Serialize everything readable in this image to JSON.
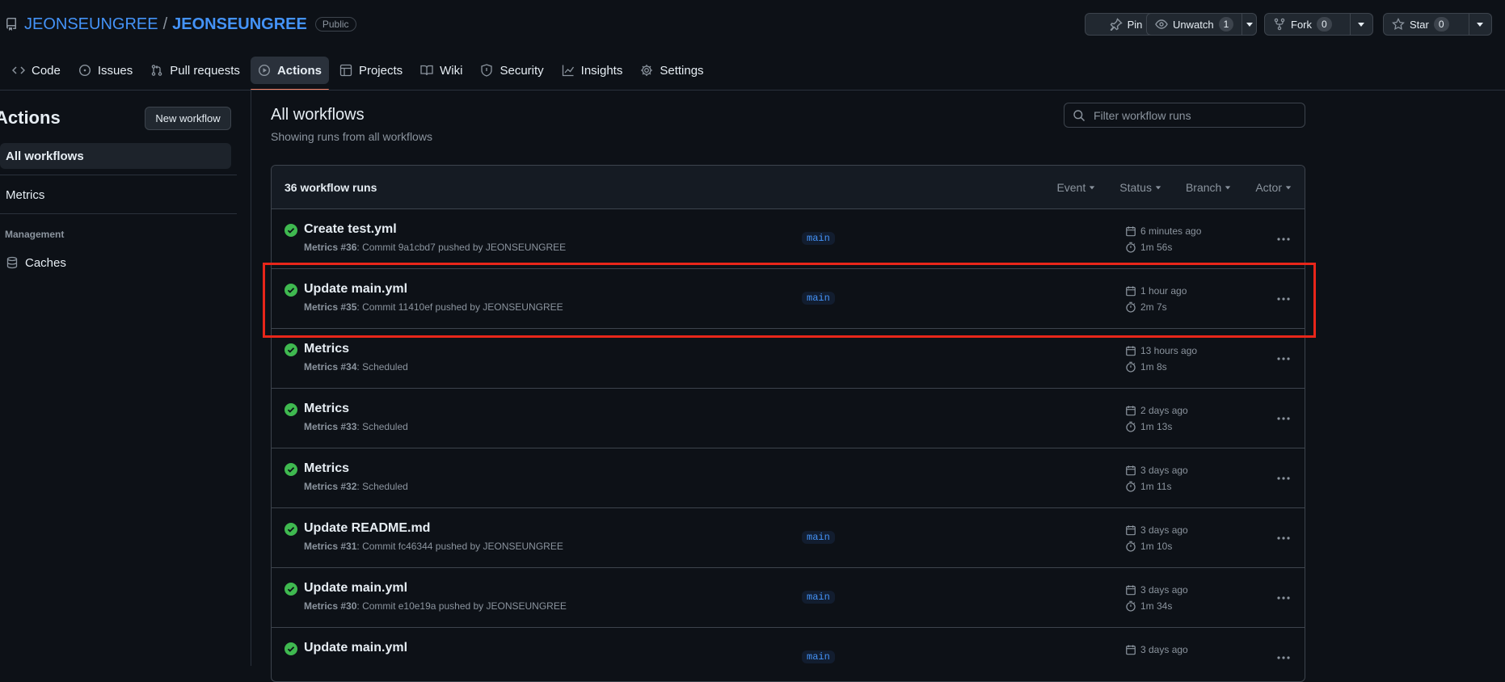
{
  "repo": {
    "owner": "JEONSEUNGREE",
    "separator": "/",
    "name": "JEONSEUNGREE",
    "visibility": "Public"
  },
  "header_buttons": {
    "pin": "Pin",
    "unwatch": "Unwatch",
    "unwatch_count": "1",
    "fork": "Fork",
    "fork_count": "0",
    "star": "Star",
    "star_count": "0"
  },
  "tabs": [
    {
      "label": "Code",
      "icon": "code-icon"
    },
    {
      "label": "Issues",
      "icon": "issue-icon"
    },
    {
      "label": "Pull requests",
      "icon": "pull-request-icon"
    },
    {
      "label": "Actions",
      "icon": "play-icon",
      "active": true
    },
    {
      "label": "Projects",
      "icon": "table-icon"
    },
    {
      "label": "Wiki",
      "icon": "book-icon"
    },
    {
      "label": "Security",
      "icon": "shield-icon"
    },
    {
      "label": "Insights",
      "icon": "graph-icon"
    },
    {
      "label": "Settings",
      "icon": "gear-icon"
    }
  ],
  "sidebar": {
    "title": "Actions",
    "new_workflow": "New workflow",
    "items": [
      "All workflows",
      "Metrics"
    ],
    "section": "Management",
    "caches": "Caches"
  },
  "main": {
    "title": "All workflows",
    "subtitle": "Showing runs from all workflows",
    "filter_placeholder": "Filter workflow runs",
    "runs_count": "36 workflow runs",
    "filters": [
      "Event",
      "Status",
      "Branch",
      "Actor"
    ]
  },
  "runs": [
    {
      "title": "Create test.yml",
      "workflow": "Metrics",
      "num": "#36",
      "desc": ": Commit 9a1cbd7 pushed by JEONSEUNGREE",
      "branch": "main",
      "when": "6 minutes ago",
      "dur": "1m 56s"
    },
    {
      "title": "Update main.yml",
      "workflow": "Metrics",
      "num": "#35",
      "desc": ": Commit 11410ef pushed by JEONSEUNGREE",
      "branch": "main",
      "when": "1 hour ago",
      "dur": "2m 7s"
    },
    {
      "title": "Metrics",
      "workflow": "Metrics",
      "num": "#34",
      "desc": ": Scheduled",
      "branch": "",
      "when": "13 hours ago",
      "dur": "1m 8s"
    },
    {
      "title": "Metrics",
      "workflow": "Metrics",
      "num": "#33",
      "desc": ": Scheduled",
      "branch": "",
      "when": "2 days ago",
      "dur": "1m 13s"
    },
    {
      "title": "Metrics",
      "workflow": "Metrics",
      "num": "#32",
      "desc": ": Scheduled",
      "branch": "",
      "when": "3 days ago",
      "dur": "1m 11s"
    },
    {
      "title": "Update README.md",
      "workflow": "Metrics",
      "num": "#31",
      "desc": ": Commit fc46344 pushed by JEONSEUNGREE",
      "branch": "main",
      "when": "3 days ago",
      "dur": "1m 10s"
    },
    {
      "title": "Update main.yml",
      "workflow": "Metrics",
      "num": "#30",
      "desc": ": Commit e10e19a pushed by JEONSEUNGREE",
      "branch": "main",
      "when": "3 days ago",
      "dur": "1m 34s"
    },
    {
      "title": "Update main.yml",
      "workflow": "",
      "num": "",
      "desc": "",
      "branch": "main",
      "when": "3 days ago",
      "dur": ""
    }
  ],
  "colors": {
    "accent": "#4493f8",
    "success": "#3fb950",
    "highlight": "#e8261a",
    "tab_underline": "#f78166"
  }
}
